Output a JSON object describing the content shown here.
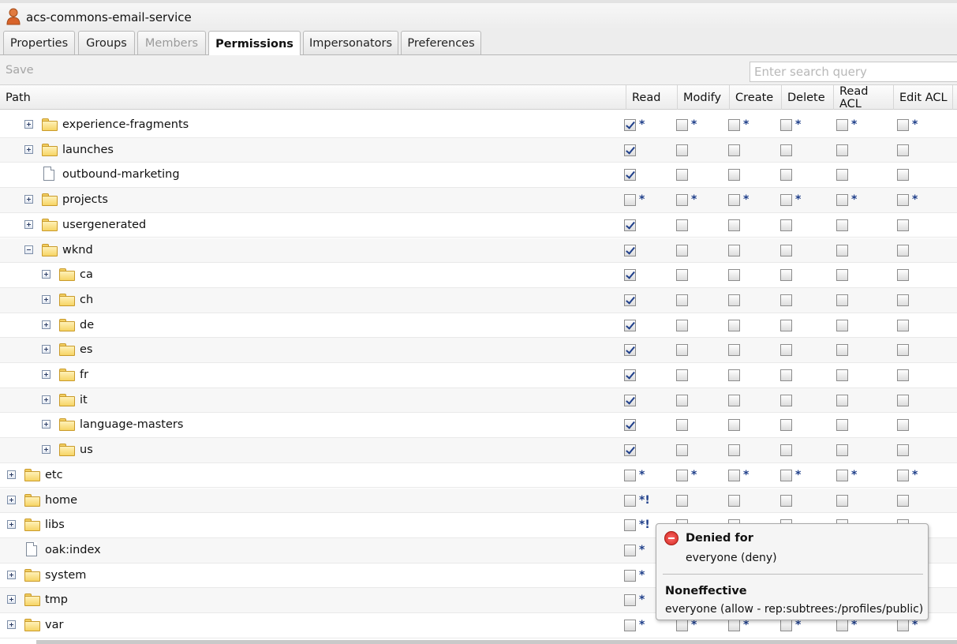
{
  "window": {
    "title": "acs-commons-email-service"
  },
  "tabs": [
    {
      "label": "Properties",
      "state": "normal"
    },
    {
      "label": "Groups",
      "state": "normal"
    },
    {
      "label": "Members",
      "state": "disabled"
    },
    {
      "label": "Permissions",
      "state": "active"
    },
    {
      "label": "Impersonators",
      "state": "normal"
    },
    {
      "label": "Preferences",
      "state": "normal"
    }
  ],
  "toolbar": {
    "save_label": "Save",
    "search_placeholder": "Enter search query"
  },
  "columns": [
    "Path",
    "Read",
    "Modify",
    "Create",
    "Delete",
    "Read ACL",
    "Edit ACL"
  ],
  "rows": [
    {
      "label": "experience-fragments",
      "level": 1,
      "kind": "folder",
      "expander": "plus",
      "perms": [
        [
          false,
          "*"
        ],
        [
          false,
          "*"
        ],
        [
          false,
          "*"
        ],
        [
          false,
          "*"
        ],
        [
          false,
          "*"
        ],
        [
          false,
          "*"
        ]
      ],
      "read_checked": true
    },
    {
      "label": "launches",
      "level": 1,
      "kind": "folder",
      "expander": "plus",
      "perms": [
        [
          true,
          ""
        ],
        [
          false,
          ""
        ],
        [
          false,
          ""
        ],
        [
          false,
          ""
        ],
        [
          false,
          ""
        ],
        [
          false,
          ""
        ]
      ]
    },
    {
      "label": "outbound-marketing",
      "level": 1,
      "kind": "file",
      "expander": "none",
      "perms": [
        [
          true,
          ""
        ],
        [
          false,
          ""
        ],
        [
          false,
          ""
        ],
        [
          false,
          ""
        ],
        [
          false,
          ""
        ],
        [
          false,
          ""
        ]
      ]
    },
    {
      "label": "projects",
      "level": 1,
      "kind": "folder",
      "expander": "plus",
      "perms": [
        [
          false,
          "*"
        ],
        [
          false,
          "*"
        ],
        [
          false,
          "*"
        ],
        [
          false,
          "*"
        ],
        [
          false,
          "*"
        ],
        [
          false,
          "*"
        ]
      ]
    },
    {
      "label": "usergenerated",
      "level": 1,
      "kind": "folder",
      "expander": "plus",
      "perms": [
        [
          true,
          ""
        ],
        [
          false,
          ""
        ],
        [
          false,
          ""
        ],
        [
          false,
          ""
        ],
        [
          false,
          ""
        ],
        [
          false,
          ""
        ]
      ]
    },
    {
      "label": "wknd",
      "level": 1,
      "kind": "folder",
      "expander": "minus",
      "perms": [
        [
          true,
          ""
        ],
        [
          false,
          ""
        ],
        [
          false,
          ""
        ],
        [
          false,
          ""
        ],
        [
          false,
          ""
        ],
        [
          false,
          ""
        ]
      ]
    },
    {
      "label": "ca",
      "level": 2,
      "kind": "folder",
      "expander": "plus",
      "perms": [
        [
          true,
          ""
        ],
        [
          false,
          ""
        ],
        [
          false,
          ""
        ],
        [
          false,
          ""
        ],
        [
          false,
          ""
        ],
        [
          false,
          ""
        ]
      ]
    },
    {
      "label": "ch",
      "level": 2,
      "kind": "folder",
      "expander": "plus",
      "perms": [
        [
          true,
          ""
        ],
        [
          false,
          ""
        ],
        [
          false,
          ""
        ],
        [
          false,
          ""
        ],
        [
          false,
          ""
        ],
        [
          false,
          ""
        ]
      ]
    },
    {
      "label": "de",
      "level": 2,
      "kind": "folder",
      "expander": "plus",
      "perms": [
        [
          true,
          ""
        ],
        [
          false,
          ""
        ],
        [
          false,
          ""
        ],
        [
          false,
          ""
        ],
        [
          false,
          ""
        ],
        [
          false,
          ""
        ]
      ]
    },
    {
      "label": "es",
      "level": 2,
      "kind": "folder",
      "expander": "plus",
      "perms": [
        [
          true,
          ""
        ],
        [
          false,
          ""
        ],
        [
          false,
          ""
        ],
        [
          false,
          ""
        ],
        [
          false,
          ""
        ],
        [
          false,
          ""
        ]
      ]
    },
    {
      "label": "fr",
      "level": 2,
      "kind": "folder",
      "expander": "plus",
      "perms": [
        [
          true,
          ""
        ],
        [
          false,
          ""
        ],
        [
          false,
          ""
        ],
        [
          false,
          ""
        ],
        [
          false,
          ""
        ],
        [
          false,
          ""
        ]
      ]
    },
    {
      "label": "it",
      "level": 2,
      "kind": "folder",
      "expander": "plus",
      "perms": [
        [
          true,
          ""
        ],
        [
          false,
          ""
        ],
        [
          false,
          ""
        ],
        [
          false,
          ""
        ],
        [
          false,
          ""
        ],
        [
          false,
          ""
        ]
      ]
    },
    {
      "label": "language-masters",
      "level": 2,
      "kind": "folder",
      "expander": "plus",
      "perms": [
        [
          true,
          ""
        ],
        [
          false,
          ""
        ],
        [
          false,
          ""
        ],
        [
          false,
          ""
        ],
        [
          false,
          ""
        ],
        [
          false,
          ""
        ]
      ]
    },
    {
      "label": "us",
      "level": 2,
      "kind": "folder",
      "expander": "plus",
      "perms": [
        [
          true,
          ""
        ],
        [
          false,
          ""
        ],
        [
          false,
          ""
        ],
        [
          false,
          ""
        ],
        [
          false,
          ""
        ],
        [
          false,
          ""
        ]
      ]
    },
    {
      "label": "etc",
      "level": 0,
      "kind": "folder",
      "expander": "plus",
      "perms": [
        [
          false,
          "*"
        ],
        [
          false,
          "*"
        ],
        [
          false,
          "*"
        ],
        [
          false,
          "*"
        ],
        [
          false,
          "*"
        ],
        [
          false,
          "*"
        ]
      ]
    },
    {
      "label": "home",
      "level": 0,
      "kind": "folder",
      "expander": "plus",
      "perms": [
        [
          false,
          "*!"
        ],
        [
          false,
          ""
        ],
        [
          false,
          ""
        ],
        [
          false,
          ""
        ],
        [
          false,
          ""
        ],
        [
          false,
          ""
        ]
      ]
    },
    {
      "label": "libs",
      "level": 0,
      "kind": "folder",
      "expander": "plus",
      "perms": [
        [
          false,
          "*!"
        ],
        [
          false,
          ""
        ],
        [
          false,
          ""
        ],
        [
          false,
          ""
        ],
        [
          false,
          ""
        ],
        [
          false,
          ""
        ]
      ]
    },
    {
      "label": "oak:index",
      "level": 0,
      "kind": "file",
      "expander": "none",
      "perms": [
        [
          false,
          "*"
        ],
        [
          false,
          ""
        ],
        [
          false,
          ""
        ],
        [
          false,
          ""
        ],
        [
          false,
          ""
        ],
        [
          false,
          ""
        ]
      ]
    },
    {
      "label": "system",
      "level": 0,
      "kind": "folder",
      "expander": "plus",
      "perms": [
        [
          false,
          "*"
        ],
        [
          false,
          ""
        ],
        [
          false,
          ""
        ],
        [
          false,
          ""
        ],
        [
          false,
          ""
        ],
        [
          false,
          ""
        ]
      ]
    },
    {
      "label": "tmp",
      "level": 0,
      "kind": "folder",
      "expander": "plus",
      "perms": [
        [
          false,
          "*"
        ],
        [
          false,
          ""
        ],
        [
          false,
          ""
        ],
        [
          false,
          ""
        ],
        [
          false,
          ""
        ],
        [
          false,
          ""
        ]
      ]
    },
    {
      "label": "var",
      "level": 0,
      "kind": "folder",
      "expander": "plus",
      "perms": [
        [
          false,
          "*"
        ],
        [
          false,
          "*"
        ],
        [
          false,
          "*"
        ],
        [
          false,
          "*"
        ],
        [
          false,
          "*"
        ],
        [
          false,
          "*"
        ]
      ]
    }
  ],
  "tooltip": {
    "denied_title": "Denied for",
    "denied_text": "everyone (deny)",
    "noneffective_title": "Noneffective",
    "noneffective_text": "everyone (allow - rep:subtrees:/profiles/public)"
  },
  "colors": {
    "check": "#1f3f8a",
    "folder": "#f6d465",
    "deny": "#d0261d"
  }
}
